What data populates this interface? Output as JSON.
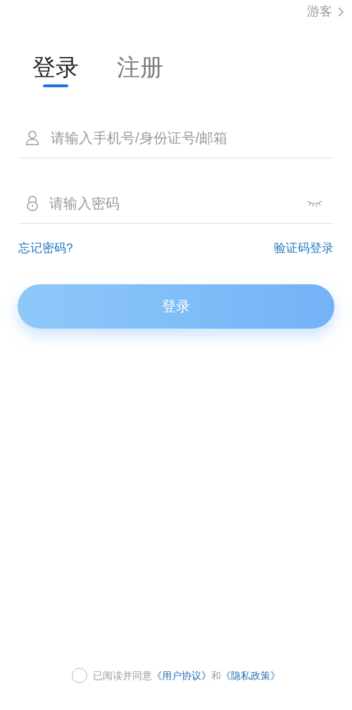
{
  "guest_link": {
    "label": "游客"
  },
  "tabs": [
    {
      "label": "登录",
      "selected": true
    },
    {
      "label": "注册",
      "selected": false
    }
  ],
  "fields": [
    {
      "kind": "account",
      "placeholder": "请输入手机号/身份证号/邮箱"
    },
    {
      "kind": "password",
      "placeholder": "请输入密码"
    }
  ],
  "links": [
    {
      "label": "忘记密码?"
    },
    {
      "label": "验证码登录"
    }
  ],
  "login_button": {
    "label": "登录"
  },
  "agreement": {
    "checked": false,
    "text": "已阅读并同意",
    "link_1": "《用户协议》",
    "joiner": "和",
    "link_2": "《隐私政策》"
  }
}
